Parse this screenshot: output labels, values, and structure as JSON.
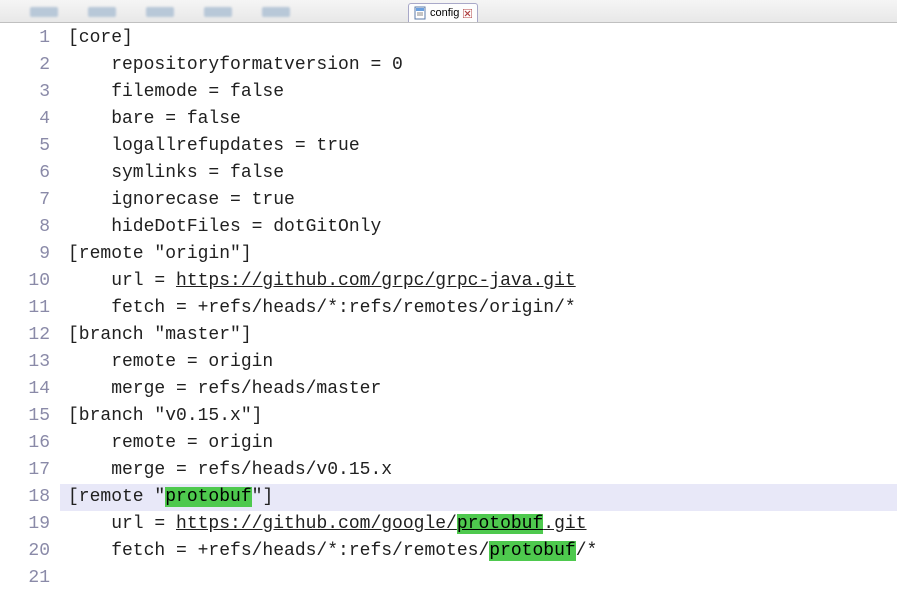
{
  "tab": {
    "label": "config",
    "icon": "file-icon",
    "close": "close-icon"
  },
  "highlight_word": "protobuf",
  "current_line": 18,
  "lines": [
    {
      "n": 1,
      "indent": 0,
      "segs": [
        {
          "t": "[core]"
        }
      ]
    },
    {
      "n": 2,
      "indent": 1,
      "segs": [
        {
          "t": "repositoryformatversion = 0"
        }
      ]
    },
    {
      "n": 3,
      "indent": 1,
      "segs": [
        {
          "t": "filemode = false"
        }
      ]
    },
    {
      "n": 4,
      "indent": 1,
      "segs": [
        {
          "t": "bare = false"
        }
      ]
    },
    {
      "n": 5,
      "indent": 1,
      "segs": [
        {
          "t": "logallrefupdates = true"
        }
      ]
    },
    {
      "n": 6,
      "indent": 1,
      "segs": [
        {
          "t": "symlinks = false"
        }
      ]
    },
    {
      "n": 7,
      "indent": 1,
      "segs": [
        {
          "t": "ignorecase = true"
        }
      ]
    },
    {
      "n": 8,
      "indent": 1,
      "segs": [
        {
          "t": "hideDotFiles = dotGitOnly"
        }
      ]
    },
    {
      "n": 9,
      "indent": 0,
      "segs": [
        {
          "t": "[remote \"origin\"]"
        }
      ]
    },
    {
      "n": 10,
      "indent": 1,
      "segs": [
        {
          "t": "url = "
        },
        {
          "t": "https://github.com/grpc/grpc-java.git",
          "link": true
        }
      ]
    },
    {
      "n": 11,
      "indent": 1,
      "segs": [
        {
          "t": "fetch = +refs/heads/*:refs/remotes/origin/*"
        }
      ]
    },
    {
      "n": 12,
      "indent": 0,
      "segs": [
        {
          "t": "[branch \"master\"]"
        }
      ]
    },
    {
      "n": 13,
      "indent": 1,
      "segs": [
        {
          "t": "remote = origin"
        }
      ]
    },
    {
      "n": 14,
      "indent": 1,
      "segs": [
        {
          "t": "merge = refs/heads/master"
        }
      ]
    },
    {
      "n": 15,
      "indent": 0,
      "segs": [
        {
          "t": "[branch \"v0.15.x\"]"
        }
      ]
    },
    {
      "n": 16,
      "indent": 1,
      "segs": [
        {
          "t": "remote = origin"
        }
      ]
    },
    {
      "n": 17,
      "indent": 1,
      "segs": [
        {
          "t": "merge = refs/heads/v0.15.x"
        }
      ]
    },
    {
      "n": 18,
      "indent": 0,
      "segs": [
        {
          "t": "[remote \""
        },
        {
          "t": "protobuf",
          "hl": true
        },
        {
          "t": "\"]"
        }
      ]
    },
    {
      "n": 19,
      "indent": 1,
      "segs": [
        {
          "t": "url = "
        },
        {
          "t": "https://github.com/google/",
          "link": true
        },
        {
          "t": "protobuf",
          "link": true,
          "hl": true
        },
        {
          "t": ".git",
          "link": true
        }
      ]
    },
    {
      "n": 20,
      "indent": 1,
      "segs": [
        {
          "t": "fetch = +refs/heads/*:refs/remotes/"
        },
        {
          "t": "protobuf",
          "hl": true
        },
        {
          "t": "/*"
        }
      ]
    },
    {
      "n": 21,
      "indent": 0,
      "segs": []
    }
  ]
}
